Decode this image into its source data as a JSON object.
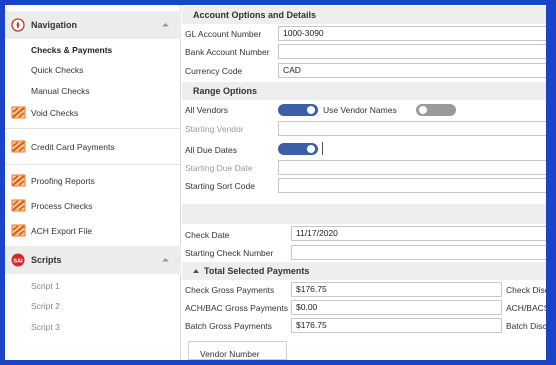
{
  "sidebar": {
    "navigation_group": {
      "label": "Navigation",
      "icon": "compass-icon"
    },
    "navigation_items": [
      {
        "label": "Checks & Payments",
        "active": true
      },
      {
        "label": "Quick Checks",
        "active": false
      },
      {
        "label": "Manual Checks",
        "active": false
      }
    ],
    "tools": [
      {
        "label": "Void Checks",
        "icon": "tool-icon"
      },
      {
        "label": "Credit Card Payments",
        "icon": "tool-icon"
      },
      {
        "label": "Proofing Reports",
        "icon": "tool-icon"
      },
      {
        "label": "Process Checks",
        "icon": "tool-icon"
      },
      {
        "label": "ACH Export File",
        "icon": "tool-icon"
      }
    ],
    "scripts_group": {
      "label": "Scripts",
      "icon": "scripts-icon",
      "badge": "SAI"
    },
    "scripts": [
      "Script 1",
      "Script 2",
      "Script 3"
    ]
  },
  "account": {
    "header": "Account Options and Details",
    "gl_label": "GL Account Number",
    "gl_value": "1000-3090",
    "bank_label": "Bank Account Number",
    "bank_value": "",
    "currency_label": "Currency Code",
    "currency_value": "CAD"
  },
  "range": {
    "header": "Range Options",
    "all_vendors_label": "All Vendors",
    "all_vendors_on": true,
    "use_vendor_names_label": "Use Vendor Names",
    "use_vendor_names_on": false,
    "starting_vendor_label": "Starting Vendor",
    "all_due_dates_label": "All Due Dates",
    "all_due_dates_on": true,
    "starting_due_date_label": "Starting Due Date",
    "starting_sort_code_label": "Starting Sort Code"
  },
  "check": {
    "check_date_label": "Check Date",
    "check_date_value": "11/17/2020",
    "starting_check_number_label": "Starting Check Number",
    "starting_check_number_value": ""
  },
  "totals": {
    "header": "Total Selected Payments",
    "rows": [
      {
        "label": "Check Gross Payments",
        "value": "$176.75",
        "right_label": "Check Discou"
      },
      {
        "label": "ACH/BAC Gross Payments",
        "value": "$0.00",
        "right_label": "ACH/BACS Di"
      },
      {
        "label": "Batch Gross Payments",
        "value": "$176.75",
        "right_label": "Batch Discou"
      }
    ]
  },
  "grid": {
    "column_header": "Vendor Number"
  },
  "colors": {
    "accent": "#3c5ea8",
    "frame": "#1a44c8",
    "tool_orange": "#e8772a",
    "scripts_red": "#d9262b"
  }
}
